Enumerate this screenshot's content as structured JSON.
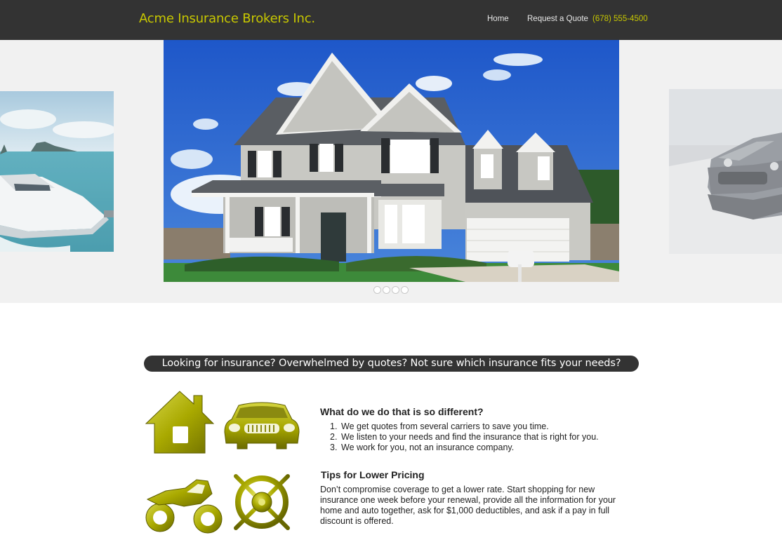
{
  "header": {
    "brand": "Acme Insurance Brokers Inc.",
    "nav": {
      "home": "Home",
      "quote": "Request a Quote"
    },
    "phone": "(678) 555-4500"
  },
  "slider": {
    "dot_count": 4,
    "slides": [
      "boat",
      "house",
      "car"
    ]
  },
  "tagline": "Looking for insurance?  Overwhelmed by quotes?  Not sure which insurance fits your needs?",
  "difference": {
    "heading": "What do we do that is so different?",
    "items": [
      {
        "num": "1.",
        "text": "We get quotes from several carriers to save you time."
      },
      {
        "num": "2.",
        "text": "We listen to your needs and find the insurance that is right for you."
      },
      {
        "num": "3.",
        "text": "We work for you, not an insurance company."
      }
    ]
  },
  "tips": {
    "heading": "Tips for Lower Pricing",
    "text": "Don’t compromise coverage to get a lower rate. Start shopping for new insurance one week before your renewal, provide all the information for your home and auto together, ask for $1,000 deductibles, and ask if a pay in full discount is offered."
  },
  "colors": {
    "header_bg": "#333333",
    "brand_accent": "#c8c800",
    "slider_bg": "#f1f1f1",
    "icon_olive": "#a8a800"
  },
  "icons": [
    "house-icon",
    "car-icon",
    "motorcycle-icon",
    "ships-wheel-icon"
  ]
}
